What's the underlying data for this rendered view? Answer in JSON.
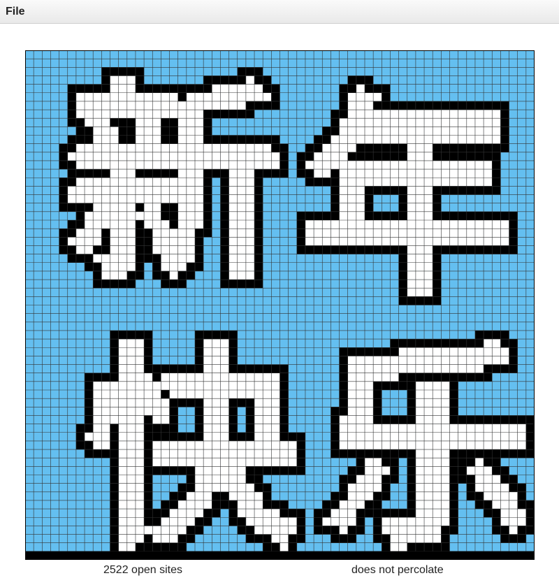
{
  "menu": {
    "items": [
      "File"
    ]
  },
  "grid": {
    "size": 60,
    "colors": {
      "blocked": "#000000",
      "open": "#ffffff",
      "full": "#64bff0",
      "gridline": "#333333"
    },
    "characters": [
      "新",
      "年",
      "快",
      "乐"
    ]
  },
  "status": {
    "open_sites": "2522 open sites",
    "percolation": "does not percolate"
  }
}
